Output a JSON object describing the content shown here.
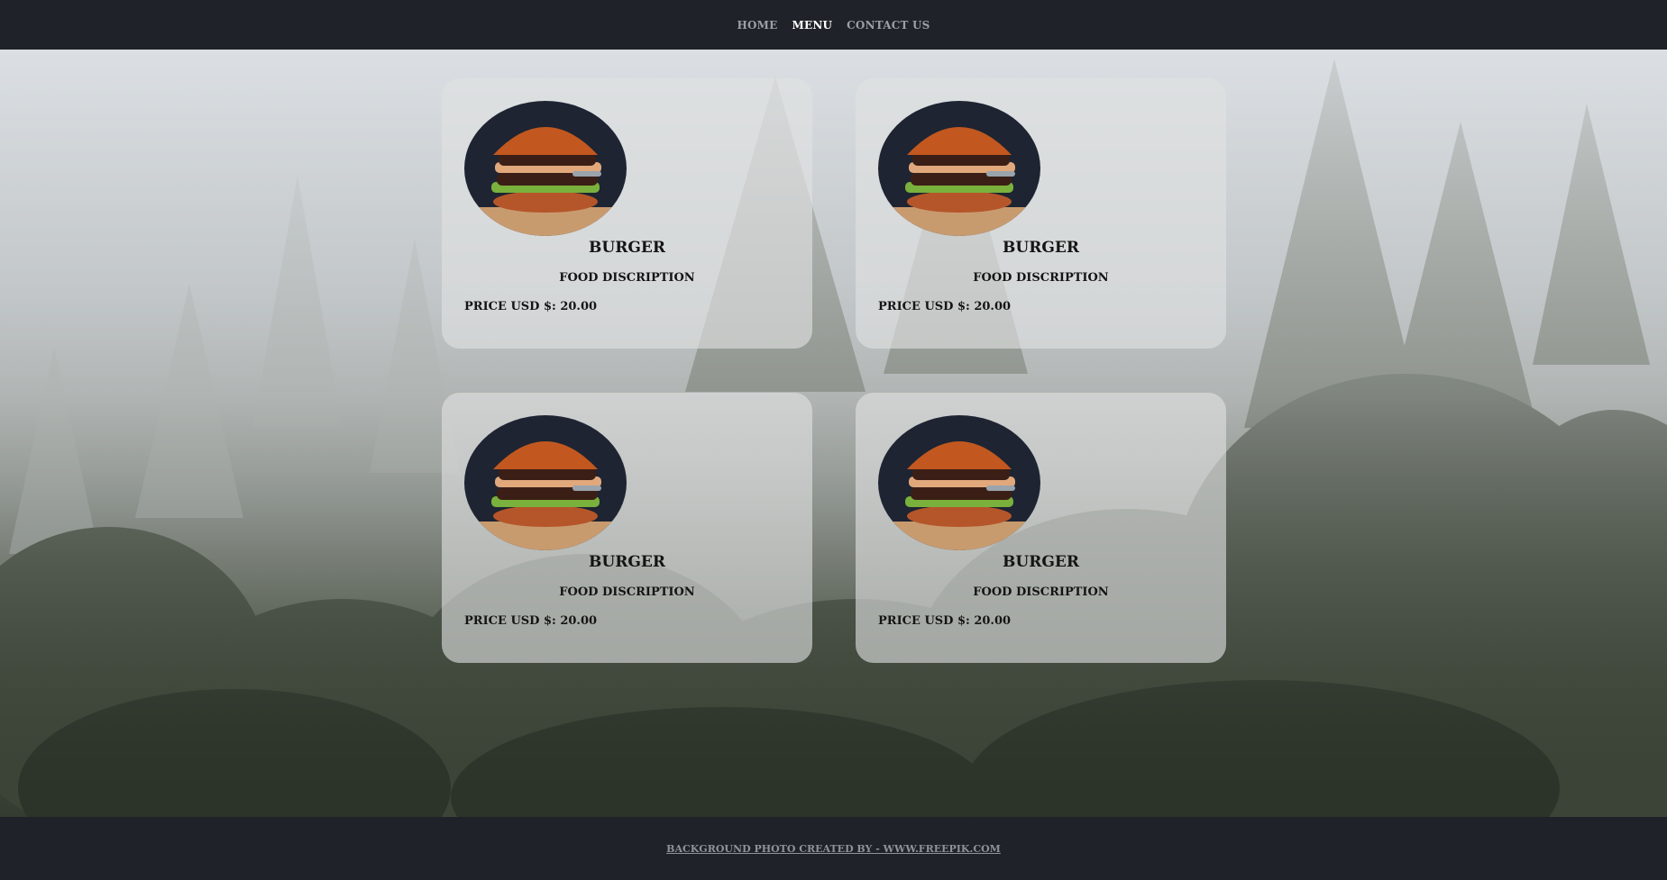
{
  "nav": {
    "items": [
      {
        "label": "HOME",
        "active": false
      },
      {
        "label": "MENU",
        "active": true
      },
      {
        "label": "CONTACT US",
        "active": false
      }
    ]
  },
  "cards": [
    {
      "title": "BURGER",
      "description": "FOOD DISCRIPTION",
      "price": "PRICE USD $: 20.00",
      "image": "burger-image"
    },
    {
      "title": "BURGER",
      "description": "FOOD DISCRIPTION",
      "price": "PRICE USD $: 20.00",
      "image": "burger-image"
    },
    {
      "title": "BURGER",
      "description": "FOOD DISCRIPTION",
      "price": "PRICE USD $: 20.00",
      "image": "burger-image"
    },
    {
      "title": "BURGER",
      "description": "FOOD DISCRIPTION",
      "price": "PRICE USD $: 20.00",
      "image": "burger-image"
    }
  ],
  "background": {
    "image": "foggy-forest-photo"
  },
  "footer": {
    "credit": "BACKGROUND PHOTO CREATED BY - WWW.FREEPIK.COM"
  },
  "colors": {
    "nav_bg": "#1f2329",
    "nav_active": "#ffffff",
    "nav_inactive": "#9aa0a6",
    "card_bg": "#e1e2e2"
  }
}
